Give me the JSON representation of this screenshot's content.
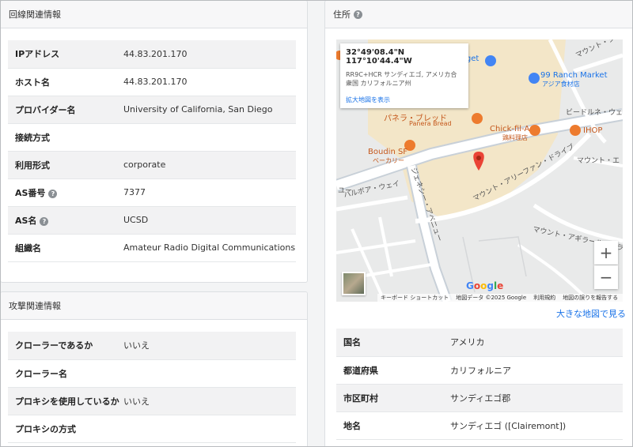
{
  "line_panel": {
    "title": "回線関連情報",
    "rows": [
      {
        "key": "IPアドレス",
        "value": "44.83.201.170",
        "help": false
      },
      {
        "key": "ホスト名",
        "value": "44.83.201.170",
        "help": false
      },
      {
        "key": "プロバイダー名",
        "value": "University of California, San Diego",
        "help": false
      },
      {
        "key": "接続方式",
        "value": "",
        "help": false
      },
      {
        "key": "利用形式",
        "value": "corporate",
        "help": false
      },
      {
        "key": "AS番号",
        "value": "7377",
        "help": true
      },
      {
        "key": "AS名",
        "value": "UCSD",
        "help": true
      },
      {
        "key": "組織名",
        "value": "Amateur Radio Digital Communications",
        "help": false
      }
    ]
  },
  "attack_panel": {
    "title": "攻撃関連情報",
    "rows": [
      {
        "key": "クローラーであるか",
        "value": "いいえ"
      },
      {
        "key": "クローラー名",
        "value": ""
      },
      {
        "key": "プロキシを使用しているか",
        "value": "いいえ"
      },
      {
        "key": "プロキシの方式",
        "value": ""
      }
    ]
  },
  "address_panel": {
    "title": "住所",
    "big_map_link": "大きな地図で見る",
    "rows": [
      {
        "key": "国名",
        "value": "アメリカ"
      },
      {
        "key": "都道府県",
        "value": "カリフォルニア"
      },
      {
        "key": "市区町村",
        "value": "サンディエゴ郡"
      },
      {
        "key": "地名",
        "value": "サンディエゴ ([Clairemont])"
      }
    ]
  },
  "map": {
    "coords": "32°49'08.4\"N 117°10'44.4\"W",
    "address": "RR9C+HCR サンディエゴ, アメリカ合衆国 カリフォルニア州",
    "enlarge_link": "拡大地図を表示",
    "zoom_in": "+",
    "zoom_out": "−",
    "google": "Google",
    "attribution": [
      "キーボード ショートカット",
      "地図データ ©2025 Google",
      "利用規約",
      "地図の誤りを報告する"
    ],
    "places": {
      "target": "rget",
      "ranch": "99 Ranch Market",
      "ranch_sub": "アジア食材店",
      "panera": "パネラ・ブレッド",
      "panera_sub": "Panera Bread",
      "chick": "Chick-fil-A",
      "chick_sub": "鶏料理店",
      "ihop": "IHOP",
      "boudin": "Boudin SF",
      "boudin_sub": "ベーカリー",
      "beedle": "ビードルネ・ウェ",
      "mount_e": "マウント・エ",
      "mount_airy": "マウント・アリーファン・ドライブ",
      "mount_aguila": "マウント・アギラール・ドライ",
      "genesee": "ジェネシー・アベニュー",
      "balboa": "バルボア・ウェイ",
      "yu": "ユー",
      "top_right": "マウント・ジャー・"
    },
    "colors": {
      "road": "#ffffff",
      "road_major": "#c8d0d8",
      "plaza": "#f3e6c8",
      "pin": "#ea4335",
      "accent": "#1a73e8"
    }
  }
}
